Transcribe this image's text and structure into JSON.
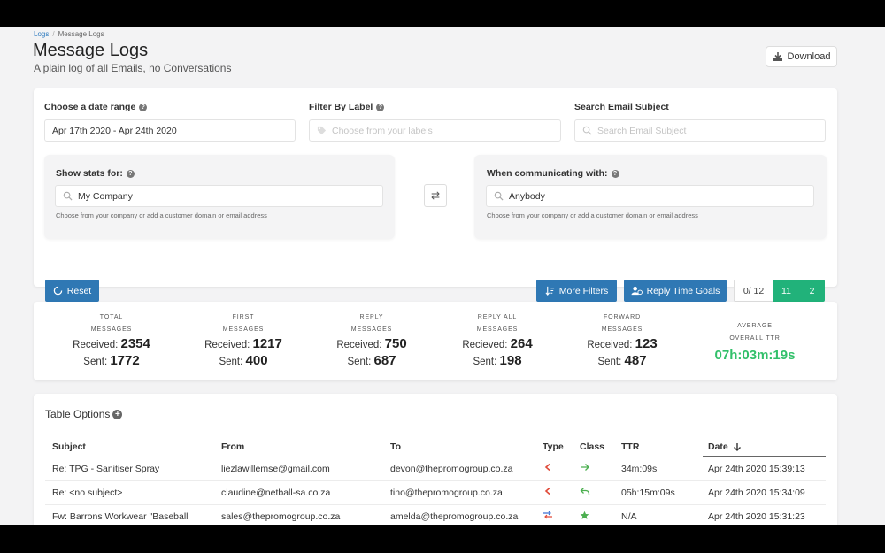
{
  "breadcrumb": {
    "link": "Logs",
    "separator": "/",
    "current": "Message Logs"
  },
  "header": {
    "title": "Message Logs",
    "subtitle": "A plain log of all Emails, no Conversations",
    "download_label": "Download"
  },
  "filters": {
    "date_range": {
      "label": "Choose a date range",
      "value": "Apr 17th 2020 - Apr 24th 2020"
    },
    "label_filter": {
      "label": "Filter By Label",
      "placeholder": "Choose from your labels"
    },
    "subject_search": {
      "label": "Search Email Subject",
      "placeholder": "Search Email Subject"
    },
    "stats_for": {
      "label": "Show stats for:",
      "value": "My Company",
      "hint": "Choose from your company or add a customer domain or email address"
    },
    "communicating_with": {
      "label": "When communicating with:",
      "value": "Anybody",
      "hint": "Choose from your company or add a customer domain or email address"
    },
    "reset_label": "Reset",
    "more_filters_label": "More Filters",
    "reply_goals_label": "Reply Time Goals",
    "goal_counter": "0/ 12",
    "goal_pills": [
      "11",
      "2"
    ]
  },
  "stats": [
    {
      "title1": "TOTAL",
      "title2": "MESSAGES",
      "received_label": "Received:",
      "received": "2354",
      "sent_label": "Sent:",
      "sent": "1772"
    },
    {
      "title1": "FIRST",
      "title2": "MESSAGES",
      "received_label": "Received:",
      "received": "1217",
      "sent_label": "Sent:",
      "sent": "400"
    },
    {
      "title1": "REPLY",
      "title2": "MESSAGES",
      "received_label": "Received:",
      "received": "750",
      "sent_label": "Sent:",
      "sent": "687"
    },
    {
      "title1": "REPLY ALL",
      "title2": "MESSAGES",
      "received_label": "Recieved:",
      "received": "264",
      "sent_label": "Sent:",
      "sent": "198"
    },
    {
      "title1": "FORWARD",
      "title2": "MESSAGES",
      "received_label": "Received:",
      "received": "123",
      "sent_label": "Sent:",
      "sent": "487"
    }
  ],
  "ttr": {
    "title1": "AVERAGE",
    "title2": "OVERALL TTR",
    "value": "07h:03m:19s"
  },
  "table": {
    "options_label": "Table Options",
    "columns": [
      "Subject",
      "From",
      "To",
      "Type",
      "Class",
      "TTR",
      "Date"
    ],
    "rows": [
      {
        "subject": "Re: TPG - Sanitiser Spray",
        "from": "liezlawillemse@gmail.com",
        "to": "devon@thepromogroup.co.za",
        "type": "received",
        "class": "forward",
        "ttr": "34m:09s",
        "date": "Apr 24th 2020 15:39:13"
      },
      {
        "subject": "Re: <no subject>",
        "from": "claudine@netball-sa.co.za",
        "to": "tino@thepromogroup.co.za",
        "type": "received",
        "class": "reply",
        "ttr": "05h:15m:09s",
        "date": "Apr 24th 2020 15:34:09"
      },
      {
        "subject": "Fw: Barrons Workwear \"Baseball",
        "from": "sales@thepromogroup.co.za",
        "to": "amelda@thepromogroup.co.za",
        "type": "internal",
        "class": "first",
        "ttr": "N/A",
        "date": "Apr 24th 2020 15:31:23"
      }
    ]
  },
  "colors": {
    "primary": "#2f78b4",
    "goal_green": "#21b27a",
    "ttr_green": "#32c06a",
    "received_red": "#e04b3a",
    "class_green": "#4caf50"
  },
  "icons": [
    "help-icon",
    "tag-icon",
    "search-icon",
    "swap-icon",
    "spinner-icon",
    "sort-icon",
    "user-clock-icon",
    "download-icon",
    "plus-icon",
    "sort-desc-icon",
    "arrow-left-icon",
    "arrow-right-icon",
    "reply-icon",
    "star-icon",
    "internal-icon"
  ]
}
